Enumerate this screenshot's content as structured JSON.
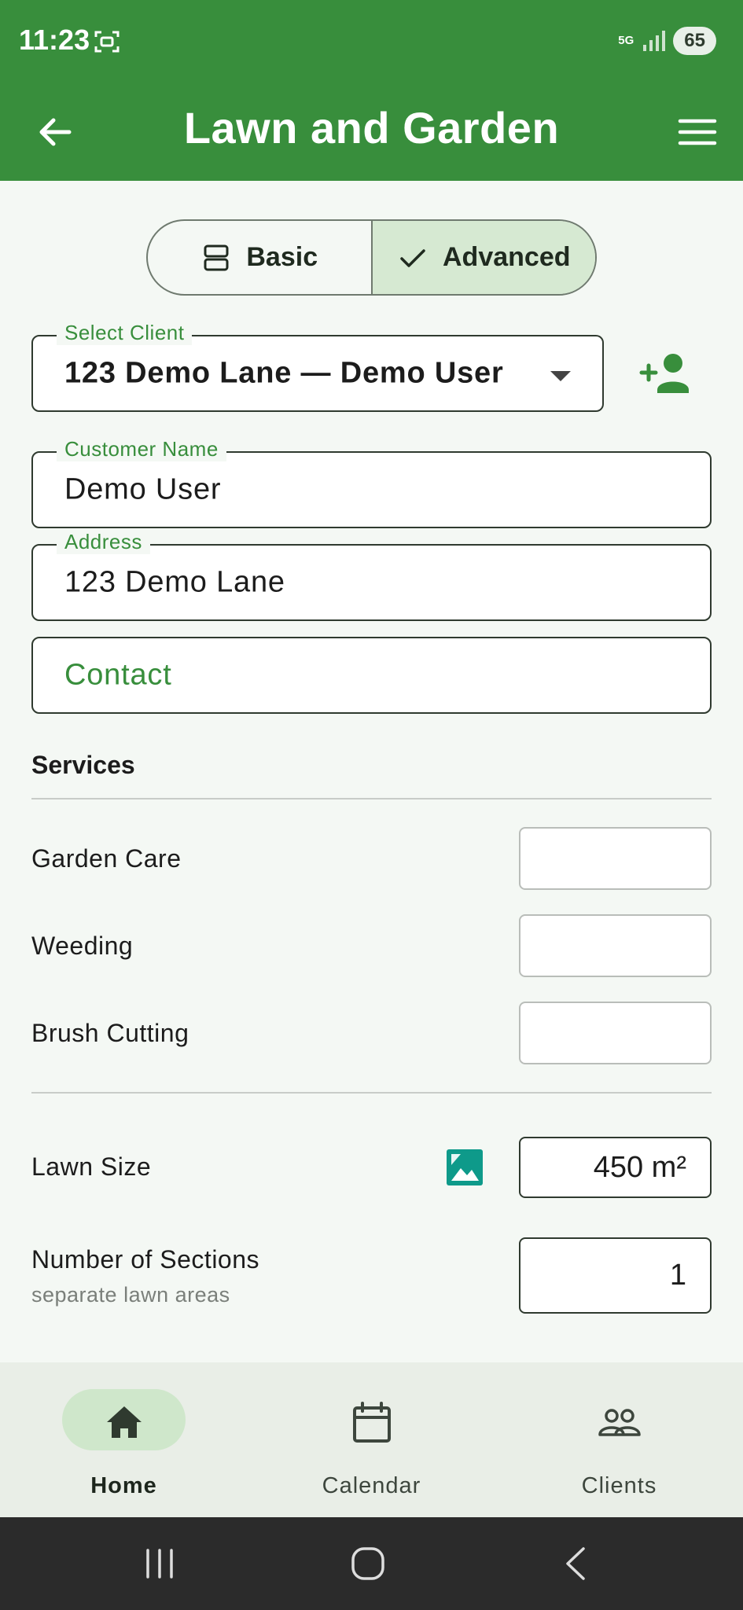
{
  "status_bar": {
    "time": "11:23",
    "network": "5G",
    "battery": "65"
  },
  "app_bar": {
    "title": "Lawn and Garden"
  },
  "mode_toggle": {
    "options": [
      {
        "label": "Basic",
        "selected": false
      },
      {
        "label": "Advanced",
        "selected": true
      }
    ]
  },
  "form": {
    "select_client": {
      "label": "Select Client",
      "value": "123 Demo Lane — Demo User"
    },
    "customer_name": {
      "label": "Customer Name",
      "value": "Demo User"
    },
    "address": {
      "label": "Address",
      "value": "123 Demo Lane"
    },
    "contact": {
      "placeholder": "Contact"
    }
  },
  "services": {
    "title": "Services",
    "items": [
      {
        "label": "Garden Care",
        "value": ""
      },
      {
        "label": "Weeding",
        "value": ""
      },
      {
        "label": "Brush Cutting",
        "value": ""
      }
    ]
  },
  "lawn_size": {
    "label": "Lawn Size",
    "value": "450 m²"
  },
  "sections": {
    "label": "Number of Sections",
    "sublabel": "separate lawn areas",
    "value": "1"
  },
  "bottom_nav": {
    "items": [
      {
        "label": "Home",
        "active": true
      },
      {
        "label": "Calendar",
        "active": false
      },
      {
        "label": "Clients",
        "active": false
      }
    ]
  },
  "colors": {
    "primary": "#388e3c",
    "selected_bg": "#d6e9d2",
    "teal_icon": "#0e9a8a"
  }
}
